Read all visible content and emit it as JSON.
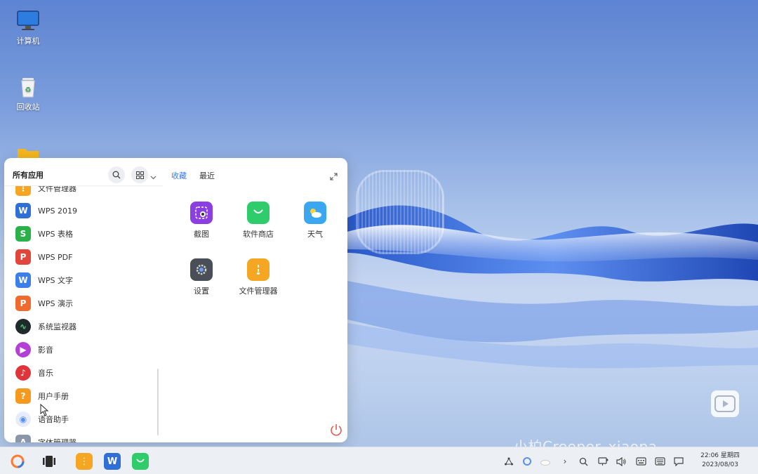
{
  "desktop": {
    "icons": [
      {
        "label": "计算机",
        "icon": "computer-icon"
      },
      {
        "label": "回收站",
        "icon": "trash-icon"
      },
      {
        "label": "",
        "icon": "folder-icon"
      }
    ]
  },
  "start_menu": {
    "all_apps_title": "所有应用",
    "tabs": {
      "favorites": "收藏",
      "recent": "最近"
    },
    "app_list": [
      {
        "label": "文件管理器",
        "icon": "file-manager-icon",
        "color": "#f5a623"
      },
      {
        "label": "WPS 2019",
        "icon": "wps-icon",
        "color": "#2f6fd6"
      },
      {
        "label": "WPS 表格",
        "icon": "wps-sheet-icon",
        "color": "#2bb04a"
      },
      {
        "label": "WPS PDF",
        "icon": "wps-pdf-icon",
        "color": "#e0463c"
      },
      {
        "label": "WPS 文字",
        "icon": "wps-writer-icon",
        "color": "#3d7fe8"
      },
      {
        "label": "WPS 演示",
        "icon": "wps-slides-icon",
        "color": "#ef6a2e"
      },
      {
        "label": "系统监视器",
        "icon": "system-monitor-icon",
        "color": "#1f2a2a"
      },
      {
        "label": "影音",
        "icon": "video-icon",
        "color": "#b43fd6"
      },
      {
        "label": "音乐",
        "icon": "music-icon",
        "color": "#e0343c"
      },
      {
        "label": "用户手册",
        "icon": "user-manual-icon",
        "color": "#f59a1e"
      },
      {
        "label": "语音助手",
        "icon": "voice-assistant-icon",
        "color": "#5a8ef0"
      },
      {
        "label": "字体管理器",
        "icon": "font-manager-icon",
        "color": "#8a97a8"
      }
    ],
    "favorites": [
      {
        "label": "截图",
        "icon": "screenshot-icon",
        "color": "#8b3fe0"
      },
      {
        "label": "软件商店",
        "icon": "software-store-icon",
        "color": "#2ecc6a"
      },
      {
        "label": "天气",
        "icon": "weather-icon",
        "color": "#3aa7f0"
      },
      {
        "label": "设置",
        "icon": "settings-icon",
        "color": "#4a4f57"
      },
      {
        "label": "文件管理器",
        "icon": "file-manager-icon",
        "color": "#f5a623"
      }
    ]
  },
  "taskbar": {
    "clock_time": "22:06 星期四",
    "clock_date": "2023/08/03"
  },
  "watermark": "小柏Creeper_xiaopa"
}
